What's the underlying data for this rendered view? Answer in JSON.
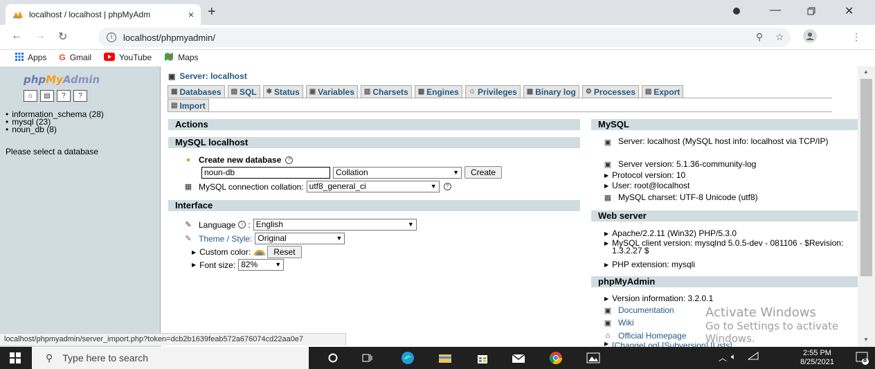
{
  "browser": {
    "tab_title": "localhost / localhost | phpMyAdm",
    "tab_close": "×",
    "new_tab": "+",
    "url": "localhost/phpmyadmin/",
    "bookmarks": [
      {
        "label": "Apps",
        "icon": "apps-icon"
      },
      {
        "label": "Gmail",
        "icon": "google-icon"
      },
      {
        "label": "YouTube",
        "icon": "youtube-icon"
      },
      {
        "label": "Maps",
        "icon": "maps-icon"
      }
    ]
  },
  "left": {
    "logo_php": "php",
    "logo_my": "My",
    "logo_admin": "Admin",
    "databases": [
      "information_schema (28)",
      "mysql (23)",
      "noun_db (8)"
    ],
    "select_prompt": "Please select a database"
  },
  "main": {
    "server_title": "Server: localhost",
    "tabs": [
      {
        "label": "Databases"
      },
      {
        "label": "SQL"
      },
      {
        "label": "Status"
      },
      {
        "label": "Variables"
      },
      {
        "label": "Charsets"
      },
      {
        "label": "Engines"
      },
      {
        "label": "Privileges"
      },
      {
        "label": "Binary log"
      },
      {
        "label": "Processes"
      },
      {
        "label": "Export"
      },
      {
        "label": "Import"
      }
    ],
    "actions_head": "Actions",
    "localhost_head": "MySQL localhost",
    "create_db_label": "Create new database",
    "create_db_value": "noun-db",
    "collation_select": "Collation",
    "create_button": "Create",
    "conn_collation_label": "MySQL connection collation:",
    "conn_collation_value": "utf8_general_ci",
    "interface_head": "Interface",
    "language_label": "Language",
    "language_value": "English",
    "theme_label": "Theme / Style:",
    "theme_value": "Original",
    "custom_color_label": "Custom color:",
    "reset_button": "Reset",
    "font_size_label": "Font size:",
    "font_size_value": "82%"
  },
  "mysql": {
    "head": "MySQL",
    "server": "Server: localhost (MySQL host info: localhost via TCP/IP)",
    "version": "Server version: 5.1.36-community-log",
    "protocol": "Protocol version: 10",
    "user": "User: root@localhost",
    "charset": "MySQL charset: UTF-8 Unicode (utf8)"
  },
  "webserver": {
    "head": "Web server",
    "apache": "Apache/2.2.11 (Win32) PHP/5.3.0",
    "client": "MySQL client version: mysqlnd 5.0.5-dev - 081106 - $Revision: 1.3.2.27 $",
    "php_ext": "PHP extension: mysqli"
  },
  "pma": {
    "head": "phpMyAdmin",
    "version": "Version information: 3.2.0.1",
    "documentation": "Documentation",
    "wiki": "Wiki",
    "homepage": "Official Homepage",
    "changelog": "[ChangeLog] [Subversion] [Lists]"
  },
  "watermark": {
    "line1": "Activate Windows",
    "line2": "Go to Settings to activate Windows."
  },
  "status_url": "localhost/phpmyadmin/server_import.php?token=dcb2b1639feab572a676074cd22aa0e7",
  "taskbar": {
    "search_placeholder": "Type here to search",
    "time": "2:55 PM",
    "date": "8/25/2021",
    "notifications": "8"
  }
}
